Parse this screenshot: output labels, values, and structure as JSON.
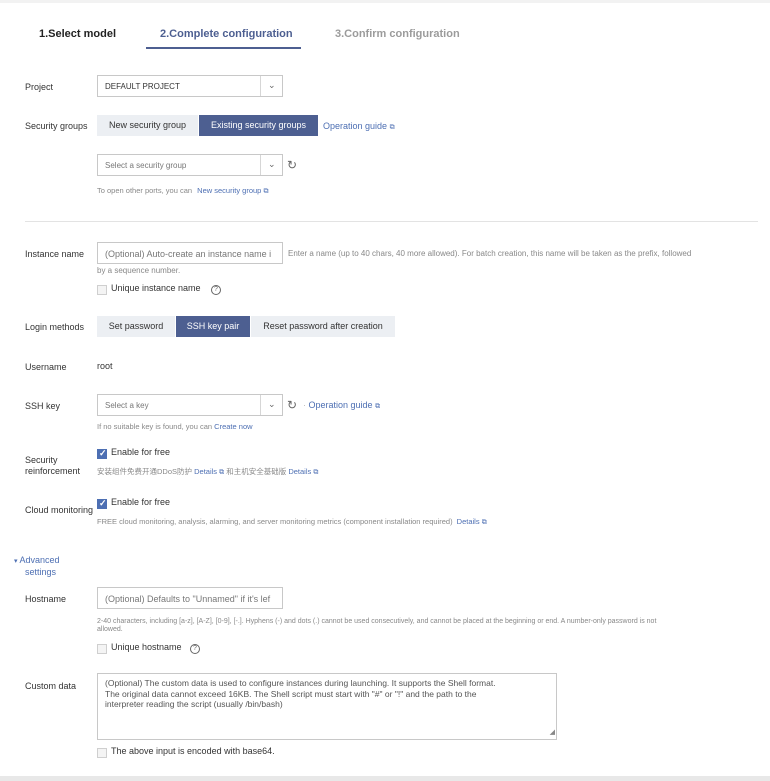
{
  "steps": [
    {
      "label": "1.Select model"
    },
    {
      "label": "2.Complete configuration"
    },
    {
      "label": "3.Confirm configuration"
    }
  ],
  "project": {
    "label": "Project",
    "value": "DEFAULT PROJECT"
  },
  "security_groups": {
    "label": "Security groups",
    "options": [
      "New security group",
      "Existing security groups"
    ],
    "selected": "Existing security groups",
    "guide_link": "Operation guide",
    "select_placeholder": "Select a security group",
    "hint_prefix": "To open other ports, you can",
    "hint_link": "New security group"
  },
  "instance_name": {
    "label": "Instance name",
    "placeholder": "(Optional) Auto-create an instance name i",
    "hint_line1": "Enter a name (up to 40 chars, 40 more allowed). For batch creation, this name will be taken as the prefix, followed",
    "hint_line2": "by a sequence number.",
    "unique_label": "Unique instance name"
  },
  "login_methods": {
    "label": "Login methods",
    "options": [
      "Set password",
      "SSH key pair",
      "Reset password after creation"
    ],
    "selected": "SSH key pair"
  },
  "username": {
    "label": "Username",
    "value": "root"
  },
  "ssh_key": {
    "label": "SSH key",
    "placeholder": "Select a key",
    "guide_link": "Operation guide",
    "hint_prefix": "If no suitable key is found, you can",
    "hint_link": "Create now"
  },
  "security_reinforcement": {
    "label_line1": "Security",
    "label_line2": "reinforcement",
    "checkbox_label": "Enable for free",
    "hint_part1": "安装组件免费开通DDoS防护",
    "details1": "Details",
    "hint_part2": "和主机安全基础版",
    "details2": "Details"
  },
  "cloud_monitoring": {
    "label": "Cloud monitoring",
    "checkbox_label": "Enable for free",
    "hint": "FREE cloud monitoring, analysis, alarming, and server monitoring metrics (component installation required)",
    "details": "Details"
  },
  "advanced": {
    "label_line1": "Advanced",
    "label_line2": "settings"
  },
  "hostname": {
    "label": "Hostname",
    "placeholder": "(Optional) Defaults to \"Unnamed\" if it's lef",
    "hint_line1": "2-40 characters, including [a-z], [A-Z], [0-9], [-.]. Hyphens (-) and dots (.) cannot be used consecutively, and cannot be placed at the beginning or end. A number-only password is not",
    "hint_line2": "allowed.",
    "unique_label": "Unique hostname"
  },
  "custom_data": {
    "label": "Custom data",
    "placeholder_line1": "(Optional) The custom data is used to configure instances during launching. It supports the Shell format.",
    "placeholder_line2": "The original data cannot exceed 16KB. The Shell script must start with \"#\" or \"!\" and the path to the",
    "placeholder_line3": "interpreter reading the script (usually /bin/bash)",
    "base64_label": "The above input is encoded with base64."
  },
  "colors": {
    "accent": "#4d5f91",
    "link": "#4d6fb3",
    "checkbox": "#4d6fb3"
  },
  "icons": [
    "chevron-down-icon",
    "refresh-icon",
    "external-link-icon",
    "question-icon",
    "check-icon",
    "caret-down-icon",
    "resize-icon"
  ]
}
